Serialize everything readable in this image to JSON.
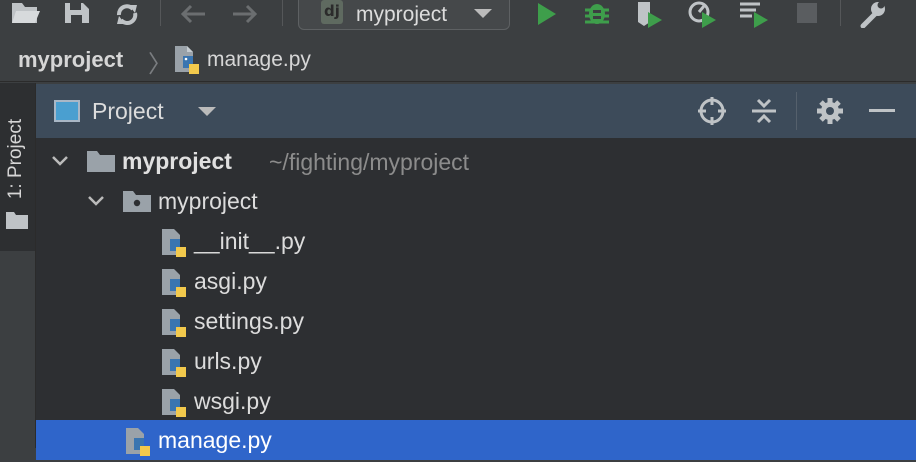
{
  "toolbar": {
    "run_config": {
      "logo": "dj",
      "label": "myproject"
    },
    "icons": [
      "open-folder-icon",
      "save-icon",
      "sync-icon",
      "back-arrow-icon",
      "forward-arrow-icon",
      "run-icon",
      "debug-icon",
      "coverage-icon",
      "profile-icon",
      "concurrency-icon",
      "stop-icon",
      "wrench-icon"
    ]
  },
  "breadcrumb": {
    "root": "myproject",
    "file": "manage.py"
  },
  "left_strip": {
    "tab_label": "1: Project"
  },
  "panel": {
    "title": "Project"
  },
  "tree": {
    "root": {
      "label": "myproject",
      "path": "~/fighting/myproject"
    },
    "package": {
      "label": "myproject"
    },
    "files": [
      "__init__.py",
      "asgi.py",
      "settings.py",
      "urls.py",
      "wsgi.py"
    ],
    "selected_file": "manage.py"
  },
  "colors": {
    "toolbar_bg": "#3c3f41",
    "panel_header_bg": "#3d4b5a",
    "tree_bg": "#2d2f32",
    "selection": "#2f65ca",
    "run_green": "#3e9e4b"
  }
}
